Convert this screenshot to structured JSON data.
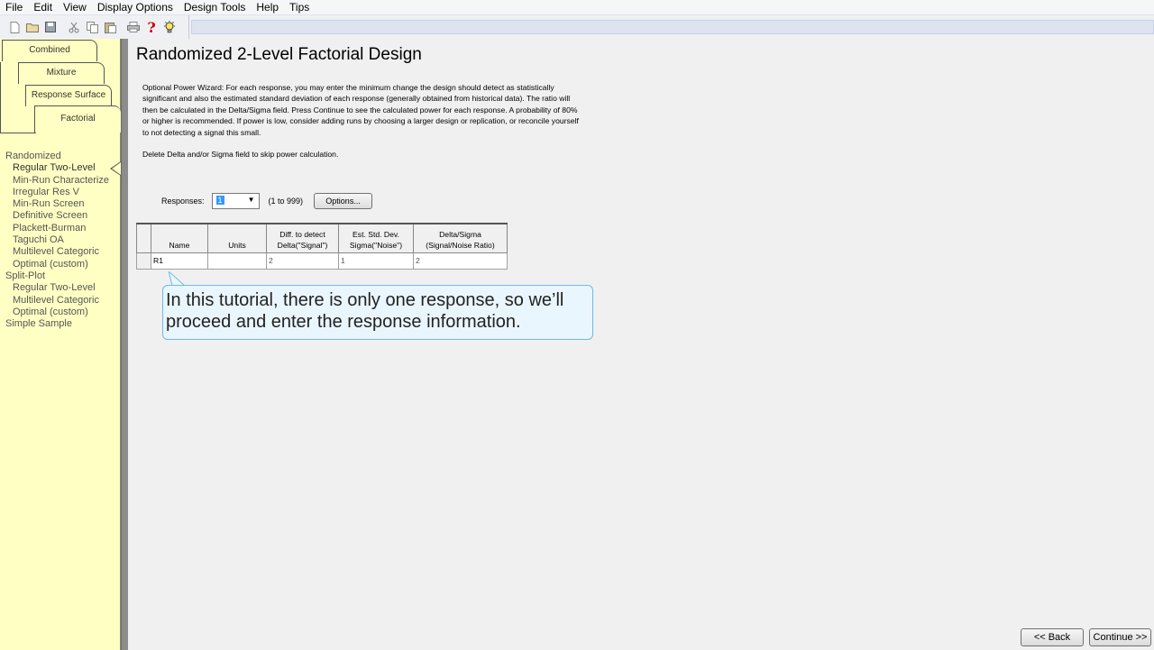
{
  "menu": [
    "File",
    "Edit",
    "View",
    "Display Options",
    "Design Tools",
    "Help",
    "Tips"
  ],
  "toolbar": {
    "icons": [
      "new-file-icon",
      "open-folder-icon",
      "save-icon",
      "cut-icon",
      "copy-icon",
      "paste-icon",
      "print-icon",
      "help-icon",
      "tips-bulb-icon"
    ]
  },
  "tabs": {
    "combined": "Combined",
    "mixture": "Mixture",
    "response_surface": "Response Surface",
    "factorial": "Factorial"
  },
  "nav": {
    "randomized": "Randomized",
    "randomized_items": [
      "Regular Two-Level",
      "Min-Run Characterize",
      "Irregular Res V",
      "Min-Run Screen",
      "Definitive Screen",
      "Plackett-Burman",
      "Taguchi OA",
      "Multilevel Categoric",
      "Optimal (custom)"
    ],
    "split_plot": "Split-Plot",
    "split_plot_items": [
      "Regular Two-Level",
      "Multilevel Categoric",
      "Optimal (custom)"
    ],
    "simple_sample": "Simple Sample"
  },
  "main": {
    "title": "Randomized 2-Level Factorial Design",
    "intro": "Optional Power Wizard: For each response, you may enter the minimum change the design should detect as statistically significant and also the estimated standard deviation of each response (generally obtained from historical data). The ratio will then be calculated in the Delta/Sigma field. Press Continue to see the calculated power for each response. A probability of 80% or higher is recommended. If power is low, consider adding runs by choosing a larger design or replication, or reconcile yourself to not detecting a signal this small.",
    "note": "Delete Delta and/or Sigma field to skip power calculation.",
    "responses_label": "Responses:",
    "responses_value": "1",
    "responses_range": "(1 to 999)",
    "options_button": "Options..."
  },
  "table": {
    "headers": [
      {
        "l1": "",
        "l2": "Name"
      },
      {
        "l1": "",
        "l2": "Units"
      },
      {
        "l1": "Diff. to detect",
        "l2": "Delta(\"Signal\")"
      },
      {
        "l1": "Est. Std. Dev.",
        "l2": "Sigma(\"Noise\")"
      },
      {
        "l1": "Delta/Sigma",
        "l2": "(Signal/Noise Ratio)"
      }
    ],
    "rows": [
      {
        "name": "R1",
        "units": "",
        "delta": "2",
        "sigma": "1",
        "ratio": "2"
      }
    ]
  },
  "callout": {
    "text": "In this tutorial, there is only one response, so we’ll proceed and enter the response information."
  },
  "buttons": {
    "back": "<< Back",
    "continue": "Continue >>"
  }
}
